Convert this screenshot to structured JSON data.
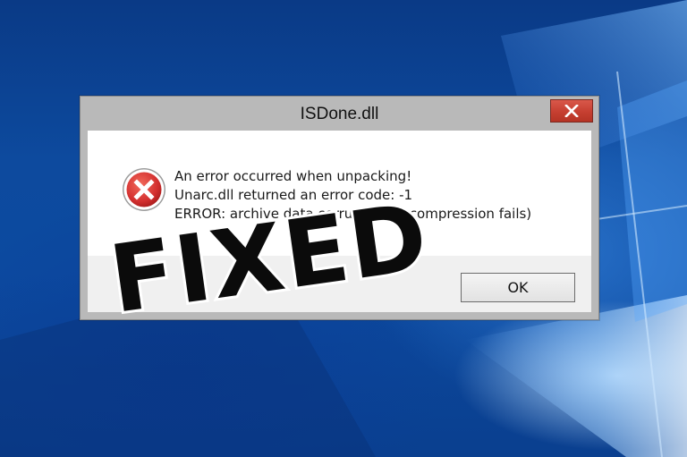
{
  "dialog": {
    "title": "ISDone.dll",
    "close_icon": "close-icon",
    "icon": "error-icon",
    "messages": [
      "An error occurred when unpacking!",
      "Unarc.dll returned an error code: -1",
      "ERROR: archive data corrupted (decompression fails)"
    ],
    "ok_label": "OK"
  },
  "overlay": {
    "stamp_text": "FIXED"
  },
  "colors": {
    "desktop_blue": "#0c4aa0",
    "close_red": "#c63f31",
    "error_red": "#d32f2f",
    "dialog_white": "#ffffff",
    "footer_gray": "#f0f0f0",
    "frame_gray": "#b9b9b9"
  }
}
